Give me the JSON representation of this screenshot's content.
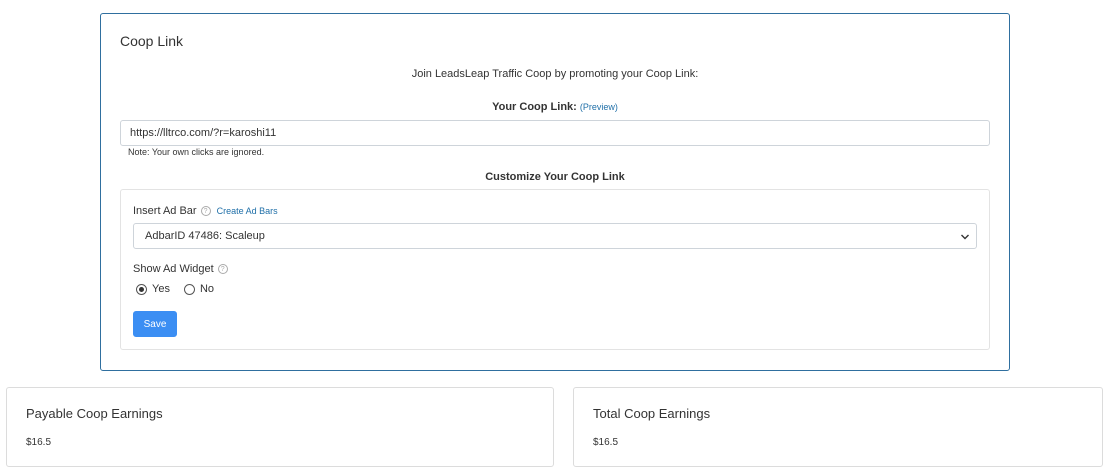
{
  "coop_card": {
    "title": "Coop Link",
    "join_text": "Join LeadsLeap Traffic Coop by promoting your Coop Link:",
    "link_heading": "Your Coop Link:",
    "preview_label": "(Preview)",
    "link_value": "https://lltrco.com/?r=karoshi11",
    "note": "Note: Your own clicks are ignored.",
    "customize_heading": "Customize Your Coop Link"
  },
  "customize": {
    "adbar_label": "Insert Ad Bar",
    "help_glyph": "?",
    "create_link": "Create Ad Bars",
    "adbar_selected": "AdbarID 47486: Scaleup",
    "widget_label": "Show Ad Widget",
    "radio_yes": "Yes",
    "radio_no": "No",
    "selected_widget": "Yes",
    "save_label": "Save",
    "accent_color": "#3b8ef3"
  },
  "earnings": {
    "payable_title": "Payable Coop Earnings",
    "payable_value": "$16.5",
    "total_title": "Total Coop Earnings",
    "total_value": "$16.5"
  }
}
